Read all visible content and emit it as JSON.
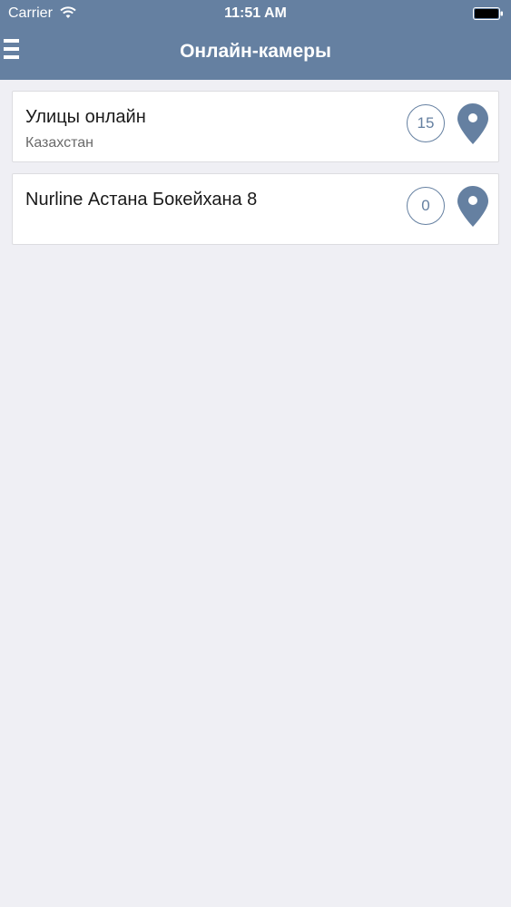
{
  "status_bar": {
    "carrier": "Carrier",
    "time": "11:51 AM",
    "wifi_icon": "wifi-icon",
    "battery_icon": "battery-icon"
  },
  "navbar": {
    "title": "Онлайн-камеры",
    "menu_icon": "hamburger-menu-icon",
    "background_color": "#6580a1"
  },
  "list": {
    "items": [
      {
        "title": "Улицы онлайн",
        "subtitle": "Казахстан",
        "count": "15",
        "icon": "map-pin-icon"
      },
      {
        "title": "Nurline Астана Бокейхана 8",
        "subtitle": "",
        "count": "0",
        "icon": "map-pin-icon"
      }
    ]
  },
  "colors": {
    "accent": "#6580a1",
    "background": "#efeff4",
    "card": "#ffffff"
  }
}
